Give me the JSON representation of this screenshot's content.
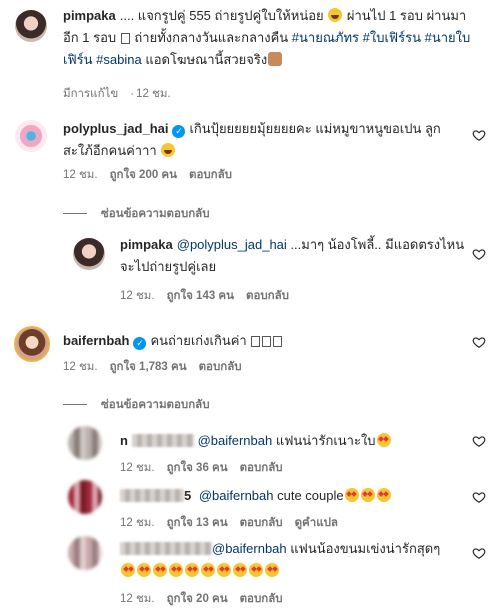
{
  "comments": [
    {
      "username": "pimpaka",
      "text_1": ".... แจกรูปคู่ 555 ถ่ายรูปคู่ใบให้หน่อย ",
      "text_2": " ผ่านไป 1 รอบ ผ่านมา อีก 1 รอบ ",
      "text_3": " ถ่ายทั้งกลางวันและกลางคืน ",
      "tags": [
        "#นายณภัทร",
        "#ใบเฟิร์รน",
        "#นายใบเฟิร์น",
        "#sabina"
      ],
      "text_4": " แอดโฆษณานี้สวยจริง",
      "meta": {
        "edited": "มีการแก้ไข",
        "time": "12 ชม."
      }
    },
    {
      "username": "polyplus_jad_hai",
      "verified": true,
      "text": "เกินปุ้ยยยยยมุ้ยยยยคะ แม่หมูขาหนูขอเปน ลูกสะใภ้อีกคนค่าาา ",
      "meta": {
        "time": "12 ชม.",
        "likes": "ถูกใจ 200 คน",
        "reply": "ตอบกลับ"
      },
      "replies_toggle": "ซ่อนข้อความตอบกลับ",
      "replies": [
        {
          "username": "pimpaka",
          "mention": "@polyplus_jad_hai",
          "text": " ...มาๆ น้องโพลี้.. มีแอดตรงไหนจะไปถ่ายรูปคู่เลย",
          "meta": {
            "time": "12 ชม.",
            "likes": "ถูกใจ 143 คน",
            "reply": "ตอบกลับ"
          }
        }
      ]
    },
    {
      "username": "baifernbah",
      "verified": true,
      "text": "คนถ่ายเก่งเกินค่า ",
      "meta": {
        "time": "12 ชม.",
        "likes": "ถูกใจ 1,783 คน",
        "reply": "ตอบกลับ"
      },
      "replies_toggle": "ซ่อนข้อความตอบกลับ",
      "replies": [
        {
          "username_visible": "n",
          "mention": "@baifernbah",
          "text": " แฟนน่ารักเนาะใบ",
          "meta": {
            "time": "12 ชม.",
            "likes": "ถูกใจ 36 คน",
            "reply": "ตอบกลับ"
          }
        },
        {
          "username_visible": "5",
          "mention": "@baifernbah",
          "text": " cute couple",
          "meta": {
            "time": "12 ชม.",
            "likes": "ถูกใจ 13 คน",
            "reply": "ตอบกลับ",
            "translate": "ดูคำแปล"
          }
        },
        {
          "mention": "@baifernbah",
          "text": " แฟนน้องขนมเข่งน่ารักสุดๆ",
          "meta": {
            "time": "12 ชม.",
            "likes": "ถูกใจ 20 คน",
            "reply": "ตอบกลับ"
          }
        }
      ]
    }
  ],
  "colors": {
    "mention": "#00376b",
    "verified": "#0095f6",
    "meta": "#737373"
  },
  "icons": {
    "like": "heart-outline-icon",
    "verified": "verified-badge-icon"
  }
}
